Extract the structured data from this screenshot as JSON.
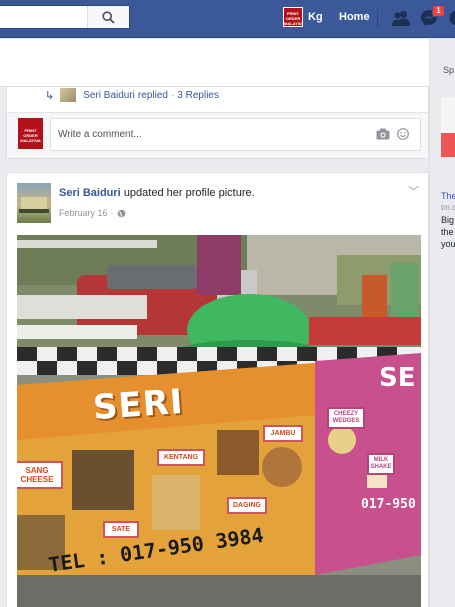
{
  "topbar": {
    "search_placeholder": "",
    "profile_name": "Kg",
    "profile_thumb_text": "PRINT ORDER MALAYSIA",
    "home_label": "Home",
    "notification_count": "1"
  },
  "feed": {
    "reply": {
      "name": "Seri Baiduri",
      "action": "replied",
      "separator": "·",
      "count": "3 Replies"
    },
    "comment": {
      "placeholder": "Write a comment...",
      "avatar_text": "PRINT ORDER MALAYSIA"
    },
    "post": {
      "author": "Seri Baiduri",
      "action": "updated her profile picture.",
      "date": "February 16",
      "separator": "·",
      "photo": {
        "banner_text": "SERI",
        "banner_text_right": "SE",
        "phone": "TEL : 017-950 3984",
        "phone_right": "017-950",
        "stickers": [
          "SANG CHEESE",
          "KENTANG",
          "JAMBU",
          "DAGING",
          "SATE",
          "CHEEZY WEDGES",
          "MILK SHAKE"
        ]
      }
    }
  },
  "colors": {
    "brand": "#3b5998",
    "link": "#365899",
    "badge": "#fa3e3e",
    "background": "#e9ebee"
  }
}
